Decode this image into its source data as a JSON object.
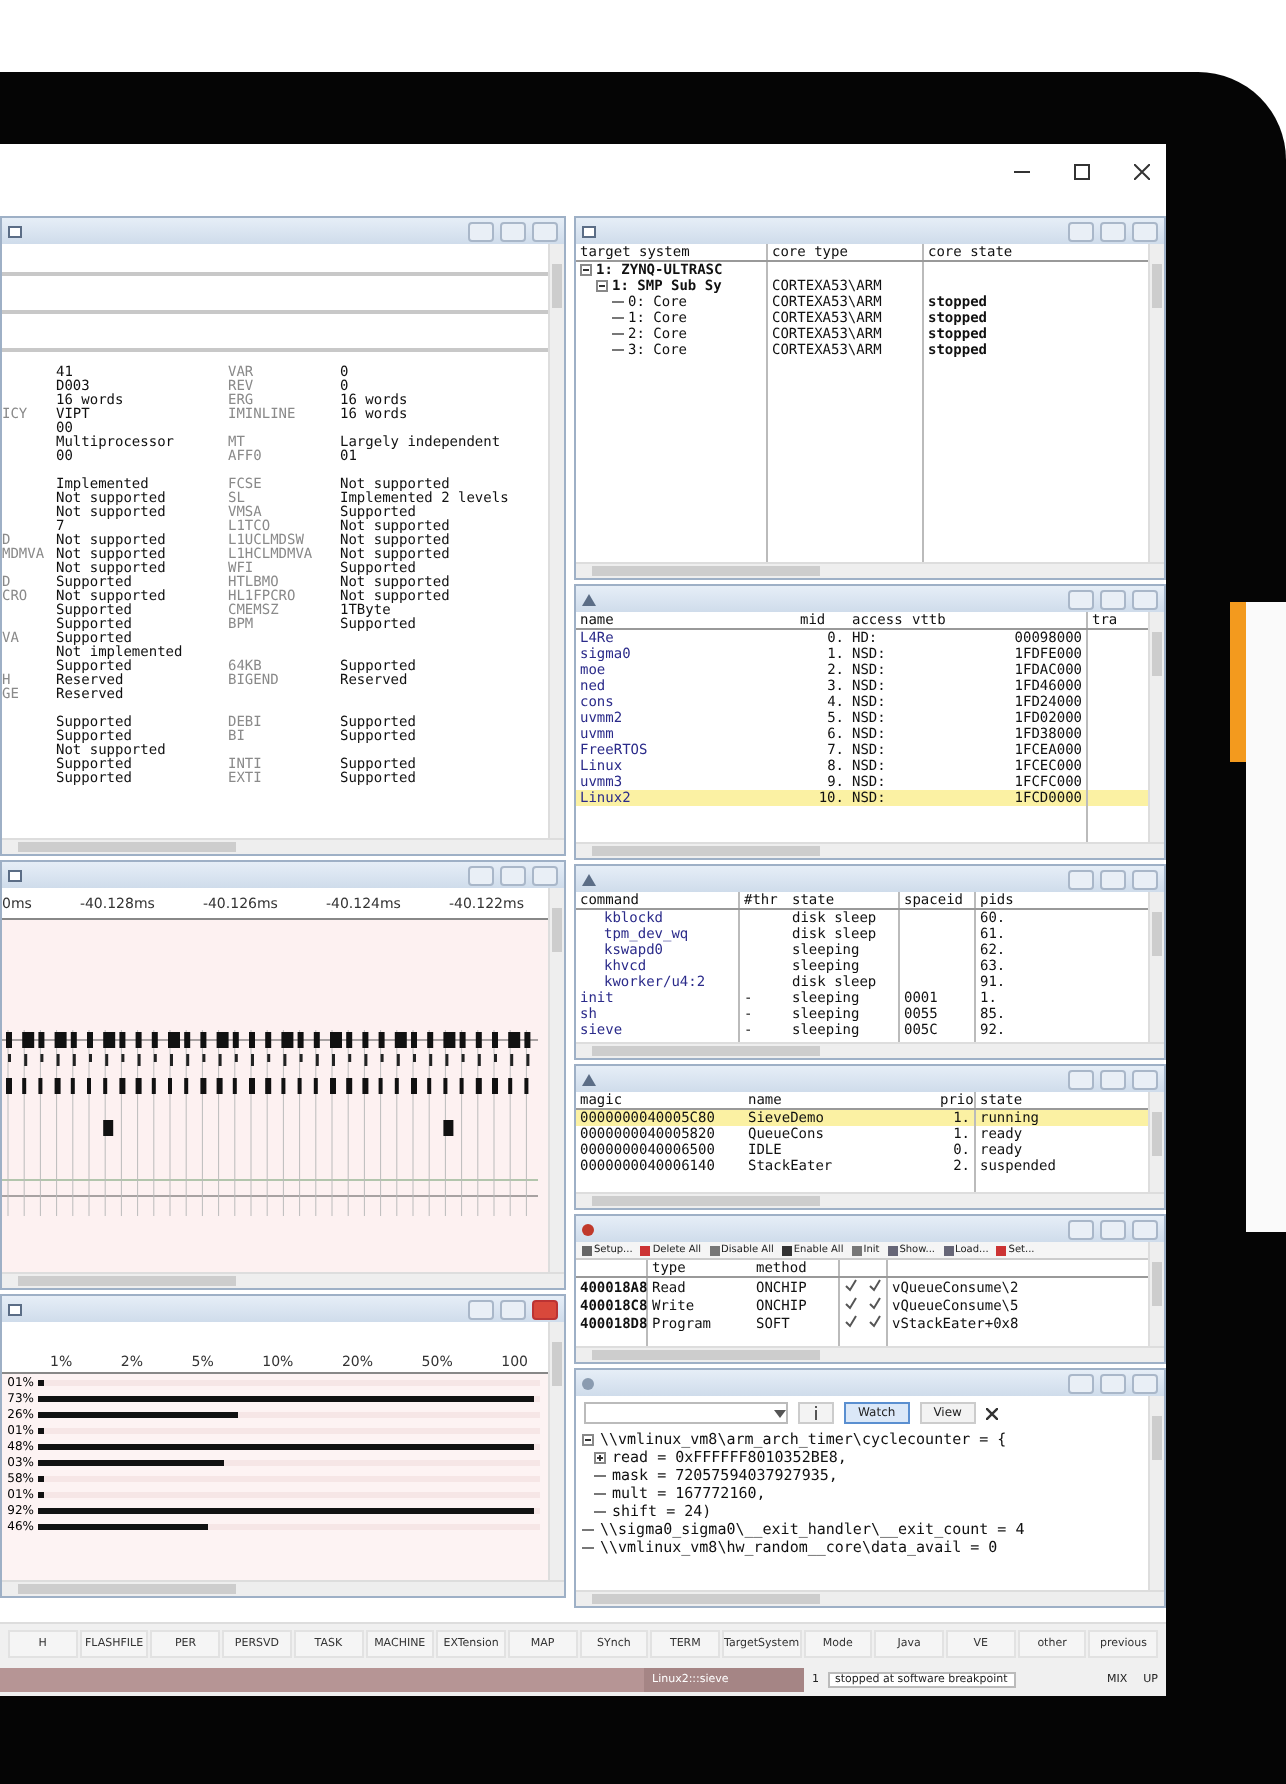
{
  "registers": {
    "rows": [
      {
        "kind": "field",
        "value_1": "41",
        "name_2": "VAR",
        "value_2": "0"
      },
      {
        "kind": "field",
        "value_1": "D003",
        "name_2": "REV",
        "value_2": "0"
      },
      {
        "kind": "field",
        "value_1": "16 words",
        "name_2": "ERG",
        "value_2": "16 words"
      },
      {
        "kind": "field",
        "name_1": "ICY",
        "value_1": "VIPT",
        "name_2": "IMINLINE",
        "value_2": "16 words"
      },
      {
        "kind": "field",
        "value_1": "00"
      },
      {
        "kind": "field",
        "value_1": "Multiprocessor",
        "name_2": "MT",
        "value_2": "Largely independent"
      },
      {
        "kind": "field",
        "value_1": "00",
        "name_2": "AFF0",
        "value_2": "01"
      },
      {
        "kind": "spacer"
      },
      {
        "kind": "field",
        "value_1": "Implemented",
        "name_2": "FCSE",
        "value_2": "Not supported"
      },
      {
        "kind": "field",
        "value_1": "Not supported",
        "name_2": "SL",
        "value_2": "Implemented 2 levels"
      },
      {
        "kind": "field",
        "value_1": "Not supported",
        "name_2": "VMSA",
        "value_2": "Supported"
      },
      {
        "kind": "field",
        "value_1": "7",
        "name_2": "L1TCO",
        "value_2": "Not supported"
      },
      {
        "kind": "field",
        "name_1": "D",
        "value_1": "Not supported",
        "name_2": "L1UCLMDSW",
        "value_2": "Not supported"
      },
      {
        "kind": "field",
        "name_1": "MDMVA",
        "value_1": "Not supported",
        "name_2": "L1HCLMDMVA",
        "value_2": "Not supported"
      },
      {
        "kind": "field",
        "value_1": "Not supported",
        "name_2": "WFI",
        "value_2": "Supported"
      },
      {
        "kind": "field",
        "name_1": "D",
        "value_1": "Supported",
        "name_2": "HTLBMO",
        "value_2": "Not supported"
      },
      {
        "kind": "field",
        "name_1": "CRO",
        "value_1": "Not supported",
        "name_2": "HL1FPCRO",
        "value_2": "Not supported"
      },
      {
        "kind": "field",
        "value_1": "Supported",
        "name_2": "CMEMSZ",
        "value_2": "1TByte"
      },
      {
        "kind": "field",
        "value_1": "Supported",
        "name_2": "BPM",
        "value_2": "Supported"
      },
      {
        "kind": "field",
        "name_1": "VA",
        "value_1": "Supported"
      },
      {
        "kind": "field",
        "value_1": "Not implemented"
      },
      {
        "kind": "field",
        "value_1": "Supported",
        "name_2": "64KB",
        "value_2": "Supported"
      },
      {
        "kind": "field",
        "name_1": "H",
        "value_1": "Reserved",
        "name_2": "BIGEND",
        "value_2": "Reserved"
      },
      {
        "kind": "field",
        "name_1": "GE",
        "value_1": "Reserved"
      },
      {
        "kind": "spacer"
      },
      {
        "kind": "field",
        "value_1": "Supported",
        "name_2": "DEBI",
        "value_2": "Supported"
      },
      {
        "kind": "field",
        "value_1": "Supported",
        "name_2": "BI",
        "value_2": "Supported"
      },
      {
        "kind": "field",
        "value_1": "Not supported"
      },
      {
        "kind": "field",
        "value_1": "Supported",
        "name_2": "INTI",
        "value_2": "Supported"
      },
      {
        "kind": "field",
        "value_1": "Supported",
        "name_2": "EXTI",
        "value_2": "Supported"
      }
    ]
  },
  "timing": {
    "axis_labels": [
      "0ms",
      "-40.128ms",
      "-40.126ms",
      "-40.124ms",
      "-40.122ms"
    ]
  },
  "histogram": {
    "axis_labels": [
      "1%",
      "2%",
      "5%",
      "10%",
      "20%",
      "50%",
      "100"
    ],
    "rows": [
      {
        "label": "01%",
        "level": 0.01
      },
      {
        "label": "73%",
        "level": 0.99
      },
      {
        "label": "26%",
        "level": 0.4
      },
      {
        "label": "01%",
        "level": 0.01
      },
      {
        "label": "48%",
        "level": 0.99
      },
      {
        "label": "03%",
        "level": 0.37
      },
      {
        "label": "58%",
        "level": 0.01
      },
      {
        "label": "01%",
        "level": 0.01
      },
      {
        "label": "92%",
        "level": 0.99
      },
      {
        "label": "46%",
        "level": 0.34
      }
    ]
  },
  "target_system": {
    "columns": [
      "target system",
      "core type",
      "core state"
    ],
    "tree": [
      {
        "name": "1: ZYNQ-ULTRASC",
        "expanded": true,
        "children": [
          {
            "name": "1: SMP Sub Sy",
            "core_type": "CORTEXA53\\ARM",
            "expanded": true,
            "children": [
              {
                "name": "0: Core",
                "core_type": "CORTEXA53\\ARM",
                "core_state": "stopped"
              },
              {
                "name": "1: Core",
                "core_type": "CORTEXA53\\ARM",
                "core_state": "stopped"
              },
              {
                "name": "2: Core",
                "core_type": "CORTEXA53\\ARM",
                "core_state": "stopped"
              },
              {
                "name": "3: Core",
                "core_type": "CORTEXA53\\ARM",
                "core_state": "stopped"
              }
            ]
          }
        ]
      }
    ]
  },
  "mmu": {
    "columns": [
      "name",
      "mid",
      "access",
      "vttb",
      "tra"
    ],
    "rows": [
      {
        "name": "L4Re",
        "mid": "0.",
        "access": "HD:",
        "vttb": "00098000",
        "selected": false
      },
      {
        "name": "sigma0",
        "mid": "1.",
        "access": "NSD:",
        "vttb": "1FDFE000",
        "selected": false
      },
      {
        "name": "moe",
        "mid": "2.",
        "access": "NSD:",
        "vttb": "1FDAC000",
        "selected": false
      },
      {
        "name": "ned",
        "mid": "3.",
        "access": "NSD:",
        "vttb": "1FD46000",
        "selected": false
      },
      {
        "name": "cons",
        "mid": "4.",
        "access": "NSD:",
        "vttb": "1FD24000",
        "selected": false
      },
      {
        "name": "uvmm2",
        "mid": "5.",
        "access": "NSD:",
        "vttb": "1FD02000",
        "selected": false
      },
      {
        "name": "uvmm",
        "mid": "6.",
        "access": "NSD:",
        "vttb": "1FD38000",
        "selected": false
      },
      {
        "name": "FreeRTOS",
        "mid": "7.",
        "access": "NSD:",
        "vttb": "1FCEA000",
        "selected": false
      },
      {
        "name": "Linux",
        "mid": "8.",
        "access": "NSD:",
        "vttb": "1FCEC000",
        "selected": false
      },
      {
        "name": "uvmm3",
        "mid": "9.",
        "access": "NSD:",
        "vttb": "1FCFC000",
        "selected": false
      },
      {
        "name": "Linux2",
        "mid": "10.",
        "access": "NSD:",
        "vttb": "1FCD0000",
        "selected": true
      }
    ]
  },
  "processes": {
    "columns": [
      "command",
      "#thr",
      "state",
      "spaceid",
      "pids"
    ],
    "rows": [
      {
        "kind": "thread",
        "command": "kblockd",
        "state": "disk sleep",
        "pids": "60."
      },
      {
        "kind": "thread",
        "command": "tpm_dev_wq",
        "state": "disk sleep",
        "pids": "61."
      },
      {
        "kind": "thread",
        "command": "kswapd0",
        "state": "sleeping",
        "pids": "62."
      },
      {
        "kind": "thread",
        "command": "khvcd",
        "state": "sleeping",
        "pids": "63."
      },
      {
        "kind": "thread",
        "command": "kworker/u4:2",
        "state": "disk sleep",
        "pids": "91."
      },
      {
        "kind": "process",
        "command": "init",
        "threads": "-",
        "state": "sleeping",
        "spaceid": "0001",
        "pids": "1."
      },
      {
        "kind": "process",
        "command": "sh",
        "threads": "-",
        "state": "sleeping",
        "spaceid": "0055",
        "pids": "85."
      },
      {
        "kind": "process",
        "command": "sieve",
        "threads": "-",
        "state": "sleeping",
        "spaceid": "005C",
        "pids": "92."
      }
    ]
  },
  "rtos_tasks": {
    "columns": [
      "magic",
      "name",
      "prio",
      "state"
    ],
    "rows": [
      {
        "magic": "0000000040005C80",
        "name": "SieveDemo",
        "prio": "1.",
        "state": "running",
        "selected": true
      },
      {
        "magic": "0000000040005820",
        "name": "QueueCons",
        "prio": "1.",
        "state": "ready",
        "selected": false
      },
      {
        "magic": "0000000040006500",
        "name": "IDLE",
        "prio": "0.",
        "state": "ready",
        "selected": false
      },
      {
        "magic": "0000000040006140",
        "name": "StackEater",
        "prio": "2.",
        "state": "suspended",
        "selected": false
      }
    ]
  },
  "breakpoints": {
    "toolbar": [
      "Setup...",
      "Delete All",
      "Disable All",
      "Enable All",
      "Init",
      "Show...",
      "Load...",
      "Set..."
    ],
    "columns": [
      "type",
      "method"
    ],
    "rows": [
      {
        "address": "400018A8",
        "type": "Read",
        "method": "ONCHIP",
        "checked": true,
        "enabled": true,
        "symbol": "vQueueConsume\\2"
      },
      {
        "address": "400018C8",
        "type": "Write",
        "method": "ONCHIP",
        "checked": true,
        "enabled": true,
        "symbol": "vQueueConsume\\5"
      },
      {
        "address": "400018D8",
        "type": "Program",
        "method": "SOFT",
        "checked": true,
        "enabled": true,
        "symbol": "vStackEater+0x8"
      }
    ]
  },
  "watch": {
    "buttons": [
      {
        "label": "Watch",
        "selected": true
      },
      {
        "label": "View",
        "selected": false
      }
    ],
    "lines": [
      {
        "kind": "struct",
        "expanded": true,
        "text": "\\\\vmlinux_vm8\\arm_arch_timer\\cyclecounter = {",
        "children": [
          {
            "kind": "struct",
            "expanded": false,
            "text": "read = 0xFFFFFF8010352BE8,"
          },
          {
            "kind": "value",
            "text": "mask = 72057594037927935,"
          },
          {
            "kind": "value",
            "text": "mult = 167772160,"
          },
          {
            "kind": "value",
            "text": "shift = 24)"
          }
        ]
      },
      {
        "kind": "value",
        "text": "\\\\sigma0_sigma0\\__exit_handler\\__exit_count = 4"
      },
      {
        "kind": "value",
        "text": "\\\\vmlinux_vm8\\hw_random__core\\data_avail = 0"
      }
    ]
  },
  "button_bar": [
    "H",
    "FLASHFILE",
    "PER",
    "PERSVD",
    "TASK",
    "MACHINE",
    "EXTension",
    "MAP",
    "SYnch",
    "TERM",
    "TargetSystem",
    "Mode",
    "Java",
    "VE",
    "other",
    "previous"
  ],
  "status_bar": {
    "context": "Linux2:::sieve",
    "count": "1",
    "message": "stopped at software breakpoint",
    "mode": "MIX",
    "state": "UP"
  }
}
